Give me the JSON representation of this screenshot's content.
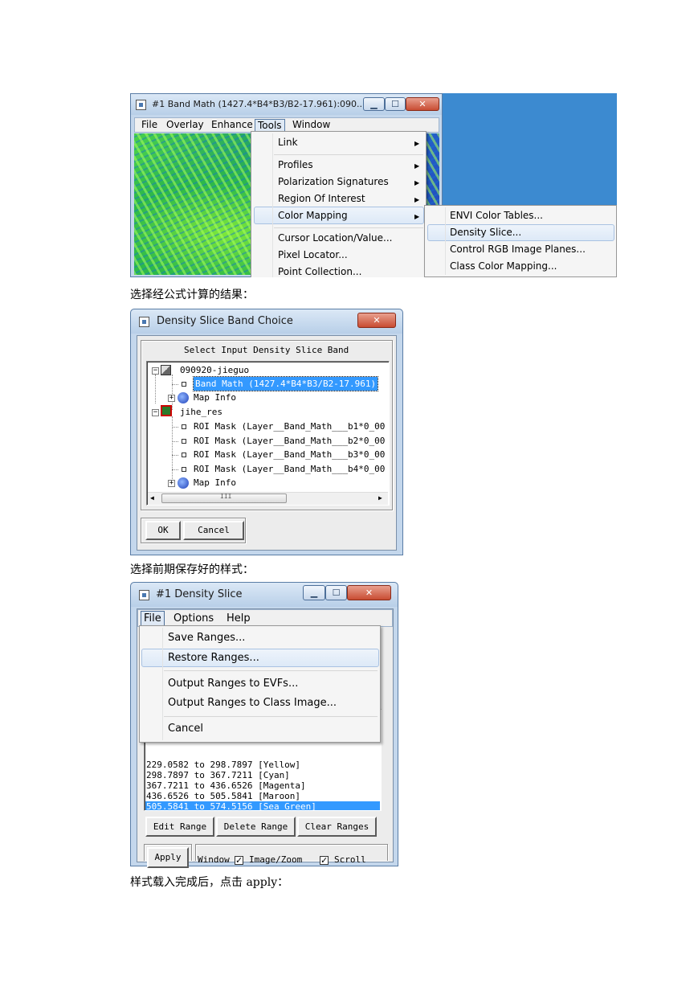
{
  "fig1": {
    "window_title": "#1 Band Math (1427.4*B4*B3/B2-17.961):090...",
    "minimize": "▁",
    "maximize": "☐",
    "close": "✕",
    "menu": [
      "File",
      "Overlay",
      "Enhance",
      "Tools",
      "Window"
    ],
    "tools_menu": [
      "Link",
      "Profiles",
      "Polarization Signatures",
      "Region Of Interest",
      "Color Mapping",
      "Cursor Location/Value...",
      "Pixel Locator...",
      "Point Collection..."
    ],
    "color_mapping_submenu": [
      "ENVI Color Tables...",
      "Density Slice...",
      "Control RGB Image Planes...",
      "Class Color Mapping..."
    ]
  },
  "caption1": "选择经公式计算的结果：",
  "fig2": {
    "window_title": "Density Slice Band Choice",
    "close": "✕",
    "panel_label": "Select Input Density Slice Band",
    "tree": {
      "file1": "090920-jieguo",
      "band": "Band Math (1427.4*B4*B3/B2-17.961)",
      "mapinfo1": "Map Info",
      "file2": "jihe_res",
      "roi1": "ROI Mask (Layer__Band_Math___b1*0_00",
      "roi2": "ROI Mask (Layer__Band_Math___b2*0_00",
      "roi3": "ROI Mask (Layer__Band_Math___b3*0_00",
      "roi4": "ROI Mask (Layer__Band_Math___b4*0_00",
      "mapinfo2": "Map Info"
    },
    "hscroll_grip": "III",
    "ok": "OK",
    "cancel": "Cancel"
  },
  "caption2": "选择前期保存好的样式：",
  "fig3": {
    "window_title": "#1 Density Slice",
    "minimize": "▁",
    "maximize": "☐",
    "close": "✕",
    "menu": [
      "File",
      "Options",
      "Help"
    ],
    "file_menu": [
      "Save Ranges...",
      "Restore Ranges...",
      "Output Ranges to EVFs...",
      "Output Ranges to Class Image...",
      "Cancel"
    ],
    "ranges": [
      "229.0582 to 298.7897 [Yellow]",
      "298.7897 to 367.7211 [Cyan]",
      "367.7211 to 436.6526 [Magenta]",
      "436.6526 to 505.5841 [Maroon]",
      "505.5841 to 574.5156 [Sea Green]"
    ],
    "edit_range": "Edit Range",
    "delete_range": "Delete Range",
    "clear_ranges": "Clear Ranges",
    "apply": "Apply",
    "window_label": "Window",
    "image_zoom": "Image/Zoom",
    "scroll": "Scroll",
    "check": "✓"
  },
  "caption3": "样式载入完成后，点击 apply："
}
